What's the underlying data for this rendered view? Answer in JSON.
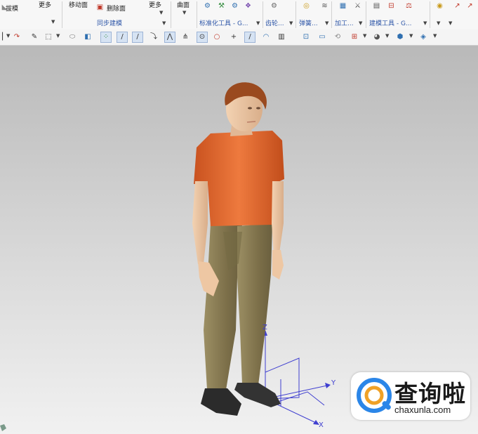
{
  "ribbon": {
    "draft_label": "拔模",
    "more_label_1": "更多",
    "move_face_label": "移动面",
    "delete_face_label": "删除面",
    "more_label_2": "更多",
    "surface_label": "曲面",
    "sync_group_label": "同步建模",
    "groups": [
      {
        "label": "标准化工具 - G..."
      },
      {
        "label": "齿轮..."
      },
      {
        "label": "弹簧..."
      },
      {
        "label": "加工..."
      },
      {
        "label": "建模工具 - G..."
      }
    ]
  },
  "watermark": {
    "title": "查询啦",
    "subtitle": "chaxunla.com"
  },
  "axes": {
    "x_label": "X",
    "y_label": "Y",
    "z_label": "Z"
  },
  "colors": {
    "shirt": "#e0672e",
    "skin": "#e9c4a3",
    "hair": "#9a4a1f",
    "pants": "#8a7d55",
    "shoes": "#2b2b2b",
    "axis": "#3f3fd0",
    "group_label": "#2f57a8",
    "watermark_blue": "#2b86e8",
    "watermark_orange": "#f0a126"
  }
}
